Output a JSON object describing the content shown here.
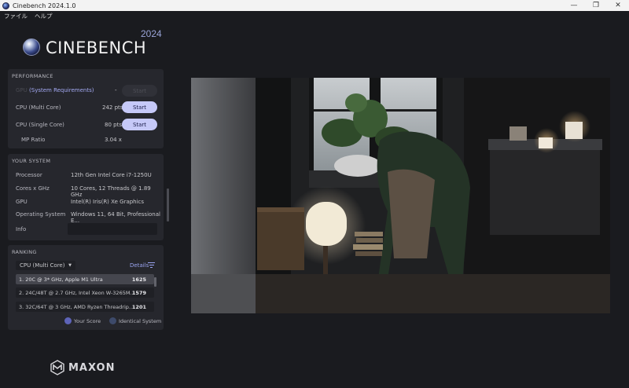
{
  "window": {
    "title": "Cinebench 2024.1.0",
    "controls": {
      "minimize": "—",
      "maximize": "❐",
      "close": "✕"
    }
  },
  "menu": {
    "file": "ファイル",
    "help": "ヘルプ"
  },
  "logo": {
    "word": "CINEBENCH",
    "year": "2024"
  },
  "performance": {
    "title": "PERFORMANCE",
    "gpu": {
      "prefix": "GPU",
      "label": "(System Requirements)",
      "value": "-",
      "button": "Start"
    },
    "multi": {
      "label": "CPU (Multi Core)",
      "value": "242 pts",
      "button": "Start"
    },
    "single": {
      "label": "CPU (Single Core)",
      "value": "80 pts",
      "button": "Start"
    },
    "ratio": {
      "label": "MP Ratio",
      "value": "3.04 x"
    }
  },
  "system": {
    "title": "YOUR SYSTEM",
    "rows": [
      {
        "label": "Processor",
        "value": "12th Gen Intel Core i7-1250U"
      },
      {
        "label": "Cores x GHz",
        "value": "10 Cores, 12 Threads @ 1.89 GHz"
      },
      {
        "label": "GPU",
        "value": "Intel(R) Iris(R) Xe Graphics"
      },
      {
        "label": "Operating System",
        "value": "Windows 11, 64 Bit, Professional E..."
      },
      {
        "label": "Info",
        "value": ""
      }
    ]
  },
  "ranking": {
    "title": "RANKING",
    "dropdown": "CPU (Multi Core)",
    "details": "Details",
    "rows": [
      {
        "label": "1. 20C @ 3* GHz, Apple M1 Ultra",
        "score": "1625"
      },
      {
        "label": "2. 24C/48T @ 2.7 GHz, Intel Xeon W-3265M...",
        "score": "1579"
      },
      {
        "label": "3. 32C/64T @ 3 GHz, AMD Ryzen Threadrip...",
        "score": "1201"
      }
    ],
    "legend": {
      "yours": "Your Score",
      "identical": "Identical System"
    }
  },
  "footer": {
    "brand": "MAXON"
  },
  "colors": {
    "accent": "#c6c9f8",
    "background": "#1a1b1f",
    "panel": "#26272d",
    "your_score_dot": "#5d63b8",
    "identical_dot": "#3d4a6a"
  }
}
